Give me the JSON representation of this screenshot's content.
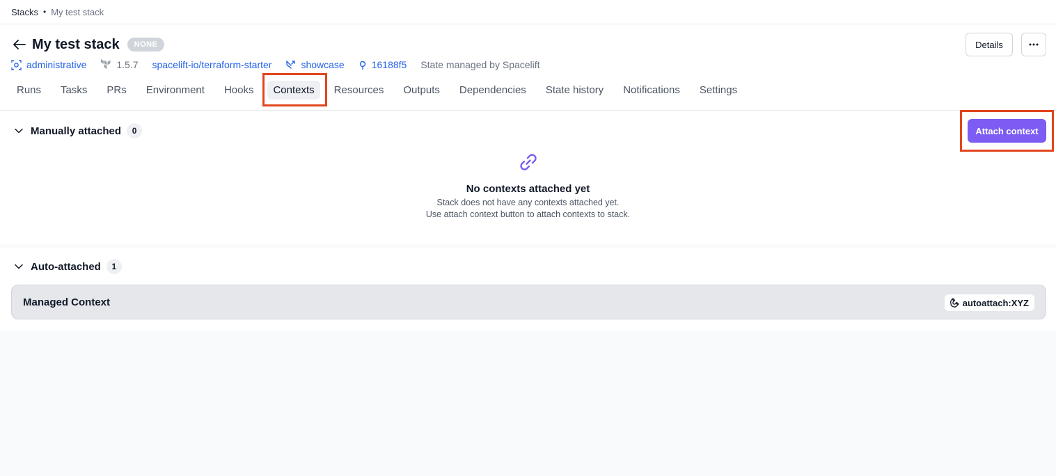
{
  "breadcrumb": {
    "root": "Stacks",
    "separator": "•",
    "current": "My test stack"
  },
  "header": {
    "title": "My test stack",
    "state_badge": "NONE",
    "details_label": "Details",
    "more_label": "•••",
    "meta": {
      "space": "administrative",
      "terraform_version": "1.5.7",
      "repository": "spacelift-io/terraform-starter",
      "branch": "showcase",
      "commit": "16188f5",
      "state": "State managed by Spacelift"
    }
  },
  "tabs": [
    {
      "label": "Runs"
    },
    {
      "label": "Tasks"
    },
    {
      "label": "PRs"
    },
    {
      "label": "Environment"
    },
    {
      "label": "Hooks"
    },
    {
      "label": "Contexts",
      "active": true
    },
    {
      "label": "Resources"
    },
    {
      "label": "Outputs"
    },
    {
      "label": "Dependencies"
    },
    {
      "label": "State history"
    },
    {
      "label": "Notifications"
    },
    {
      "label": "Settings"
    }
  ],
  "manual": {
    "title": "Manually attached",
    "count": "0",
    "attach_label": "Attach context",
    "empty_title": "No contexts attached yet",
    "empty_line1": "Stack does not have any contexts attached yet.",
    "empty_line2": "Use attach context button to attach contexts to stack."
  },
  "auto": {
    "title": "Auto-attached",
    "count": "1",
    "contexts": [
      {
        "name": "Managed Context",
        "label": "autoattach:XYZ"
      }
    ]
  },
  "colors": {
    "accent": "#7c5cf2",
    "link": "#2563eb",
    "highlight": "#e2451e"
  },
  "icons": [
    "arrow-left-icon",
    "space-icon",
    "terraform-icon",
    "branch-icon",
    "commit-icon",
    "chevron-down-icon",
    "link-icon",
    "magnet-icon"
  ]
}
